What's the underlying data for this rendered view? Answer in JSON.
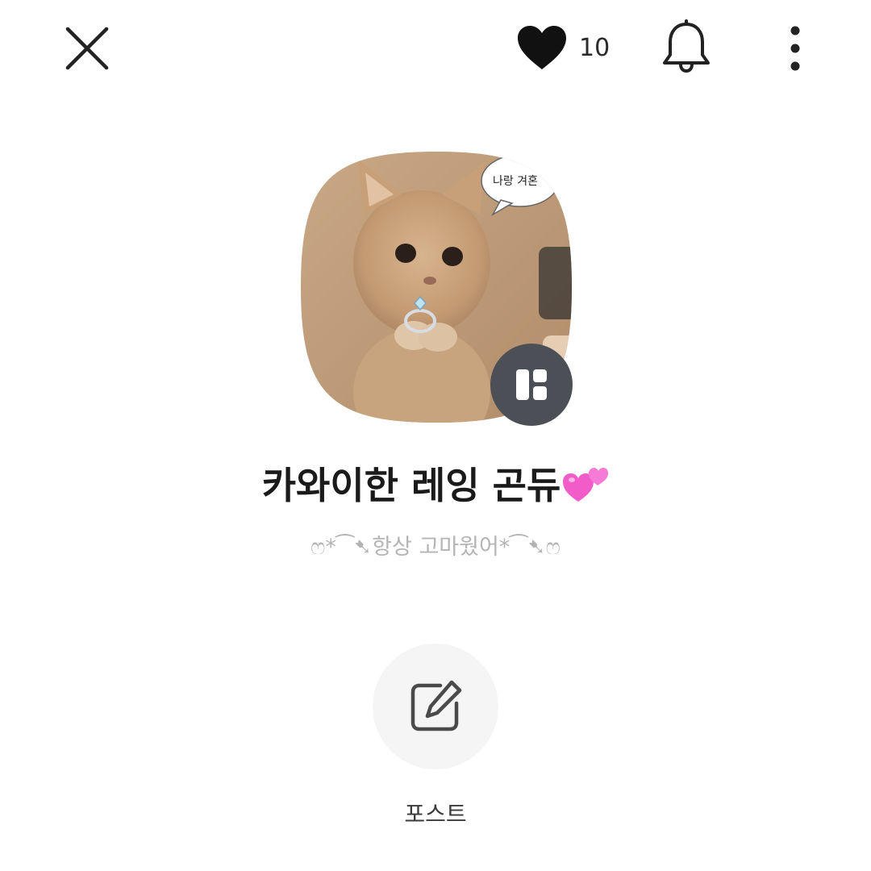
{
  "header": {
    "close_icon": "close-icon",
    "like_icon": "heart-icon",
    "like_count": "10",
    "bell_icon": "bell-icon",
    "more_icon": "more-vertical-icon"
  },
  "profile": {
    "avatar_bubble_text": "나랑 겨혼",
    "name": "카와이한 레잉 곤듀",
    "name_emoji": "two-hearts-emoji",
    "status_message": "ෆ*⁀➷항상 고마웠어*⁀➷ෆ",
    "badge_icon": "layout-icon"
  },
  "actions": {
    "post_icon": "edit-icon",
    "post_label": "포스트"
  },
  "colors": {
    "badge_bg": "#4c4f55",
    "status_text": "#b4b4b4",
    "emoji_pink": "#f25cc8"
  }
}
